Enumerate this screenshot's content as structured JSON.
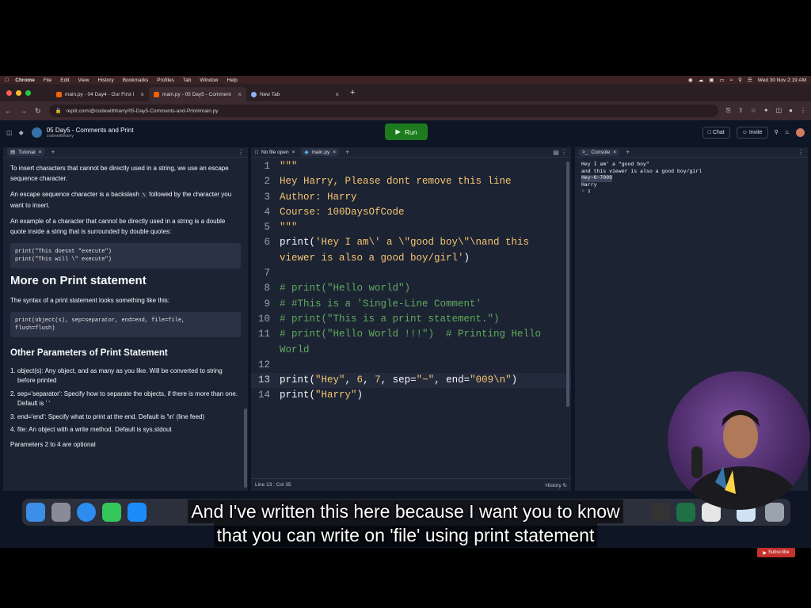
{
  "mac_menubar": {
    "app_name": "Chrome",
    "items": [
      "File",
      "Edit",
      "View",
      "History",
      "Bookmarks",
      "Profiles",
      "Tab",
      "Window",
      "Help"
    ],
    "clock": "Wed 30 Nov  2:19 AM"
  },
  "browser": {
    "tabs": [
      {
        "title": "main.py - 04 Day4 - Our First I",
        "active": false
      },
      {
        "title": "main.py - 05 Day5 - Comment",
        "active": true
      },
      {
        "title": "New Tab",
        "active": false
      }
    ],
    "url": "replit.com/@codewithharry/05-Day5-Comments-and-Print#main.py"
  },
  "replit_header": {
    "repl_name": "05 Day5 - Comments and Print",
    "owner": "codewithharry",
    "run_label": "Run",
    "chat_label": "Chat",
    "invite_label": "Invite"
  },
  "tutorial": {
    "tab_label": "Tutorial",
    "p1": "To insert characters that cannot be directly used in a string, we use an escape sequence character.",
    "p2_before": "An escape sequence character is a backslash",
    "p2_kbd": "\\",
    "p2_after": "followed by the character you want to insert.",
    "p3": "An example of a character that cannot be directly used in a string is a double quote inside a string that is surrounded by double quotes:",
    "code1": [
      "print(\"This doesnt \"execute\")",
      "print(\"This will \\\" execute\")"
    ],
    "h2": "More on Print statement",
    "p4": "The syntax of a print statement looks something like this:",
    "code2": [
      "print(object(s), sep=separator, end=end, file=file,",
      "flush=flush)"
    ],
    "h3": "Other Parameters of Print Statement",
    "list": [
      "1. object(s): Any object, and as many as you like. Will be converted to string before printed",
      "2. sep='separator': Specify how to separate the objects, if there is more than one. Default is ' '",
      "3. end='end': Specify what to print at the end. Default is '\\n' (line feed)",
      "4. file: An object with a write method. Default is sys.stdout"
    ],
    "p5": "Parameters 2 to 4 are optional"
  },
  "editor": {
    "tabs": [
      "No file open",
      "main.py"
    ],
    "status_position": "Line 13 : Col 35",
    "history_label": "History"
  },
  "console": {
    "tab_label": "Console",
    "lines": [
      "Hey I am' a \"good boy\"",
      "and this viewer is also a good boy/girl",
      "Hey~6~7009",
      "Harry"
    ],
    "prompt": "> "
  },
  "subtitle": {
    "line1": "And I've written this here because I want you to know",
    "line2": "that you can write on 'file' using print statement"
  },
  "subscribe_label": "Subscribe",
  "colors": {
    "run_green": "#1e7a1e",
    "string_yellow": "#f5c571",
    "comment_green": "#61ab5d",
    "ide_bg": "#0e1525",
    "panel_bg": "#1c2333"
  }
}
